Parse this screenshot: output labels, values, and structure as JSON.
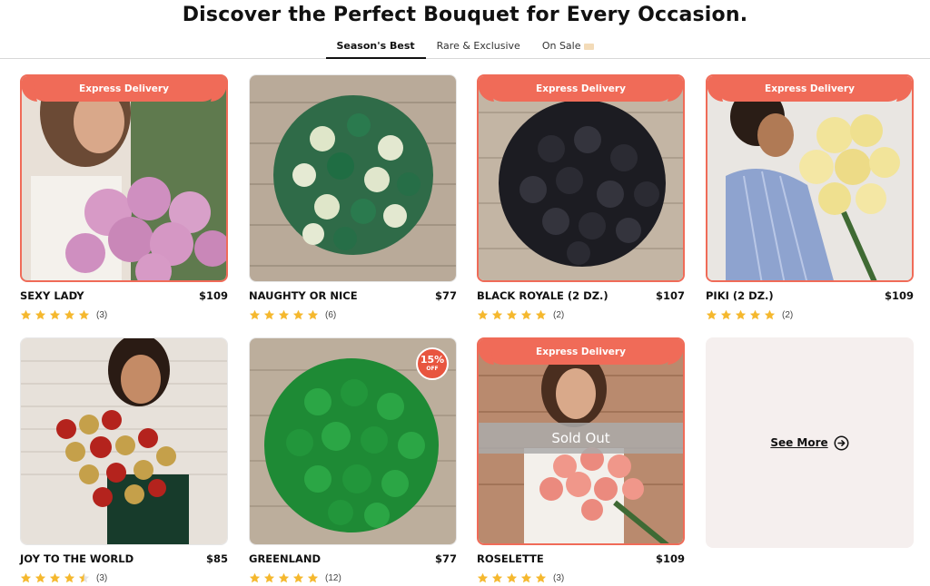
{
  "page": {
    "title": "Discover the Perfect Bouquet for Every Occasion."
  },
  "tabs": [
    {
      "label": "Season's Best",
      "active": true
    },
    {
      "label": "Rare & Exclusive",
      "active": false
    },
    {
      "label": "On Sale",
      "active": false
    }
  ],
  "products": [
    {
      "name": "SEXY LADY",
      "price": "$109",
      "rating": 5,
      "reviews": "(3)",
      "ribbon": "Express Delivery",
      "image": "pink roses bouquet held by woman"
    },
    {
      "name": "NAUGHTY OR NICE",
      "price": "$77",
      "rating": 5,
      "reviews": "(6)",
      "ribbon": "",
      "image": "green and white roses on wood"
    },
    {
      "name": "BLACK ROYALE (2 DZ.)",
      "price": "$107",
      "rating": 5,
      "reviews": "(2)",
      "ribbon": "Express Delivery",
      "image": "black roses bouquet on wood"
    },
    {
      "name": "PIKI (2 DZ.)",
      "price": "$109",
      "rating": 5,
      "reviews": "(2)",
      "ribbon": "Express Delivery",
      "image": "woman holding yellow roses"
    },
    {
      "name": "JOY TO THE WORLD",
      "price": "$85",
      "rating": 4.5,
      "reviews": "(3)",
      "ribbon": "",
      "image": "woman holding red and gold roses"
    },
    {
      "name": "GREENLAND",
      "price": "$77",
      "rating": 5,
      "reviews": "(12)",
      "ribbon": "",
      "badge": {
        "pct": "15%",
        "off": "OFF"
      },
      "image": "green roses on wood"
    },
    {
      "name": "ROSELETTE",
      "price": "$109",
      "rating": 5,
      "reviews": "(3)",
      "ribbon": "Express Delivery",
      "sold_out": "Sold Out",
      "image": "woman holding peach roses"
    }
  ],
  "see_more": {
    "label": "See More"
  },
  "colors": {
    "accent": "#f06b58",
    "star": "#f5b82e",
    "tile": "#f5efee"
  }
}
